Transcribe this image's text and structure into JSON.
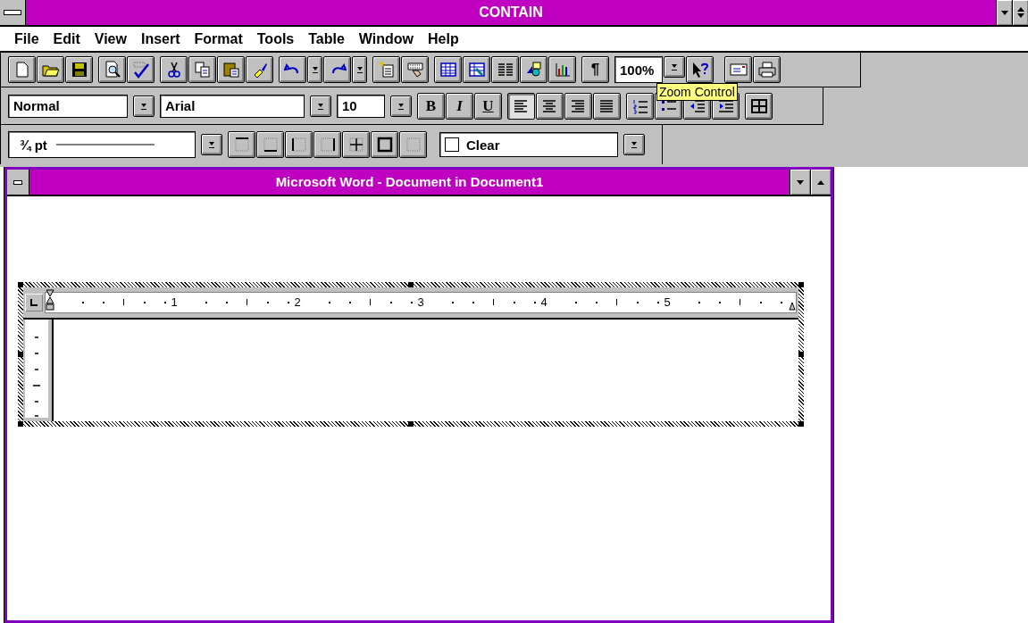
{
  "app_window": {
    "title": "CONTAIN"
  },
  "menu": [
    "File",
    "Edit",
    "View",
    "Insert",
    "Format",
    "Tools",
    "Table",
    "Window",
    "Help"
  ],
  "standard_toolbar": {
    "zoom": "100%",
    "pilcrow": "¶",
    "tooltip": "Zoom Control"
  },
  "formatting_toolbar": {
    "style": "Normal",
    "font": "Arial",
    "size": "10",
    "bold": "B",
    "italic": "I",
    "underline": "U",
    "alignment": [
      {
        "kind": "left",
        "selected": true
      },
      {
        "kind": "center",
        "selected": false
      },
      {
        "kind": "right",
        "selected": false
      },
      {
        "kind": "justify",
        "selected": false
      }
    ]
  },
  "borders_toolbar": {
    "line": "¾ pt",
    "shading": "Clear"
  },
  "document_window": {
    "title": "Microsoft Word  - Document in Document1",
    "ruler_numbers": [
      "1",
      "2",
      "3",
      "4",
      "5"
    ]
  }
}
